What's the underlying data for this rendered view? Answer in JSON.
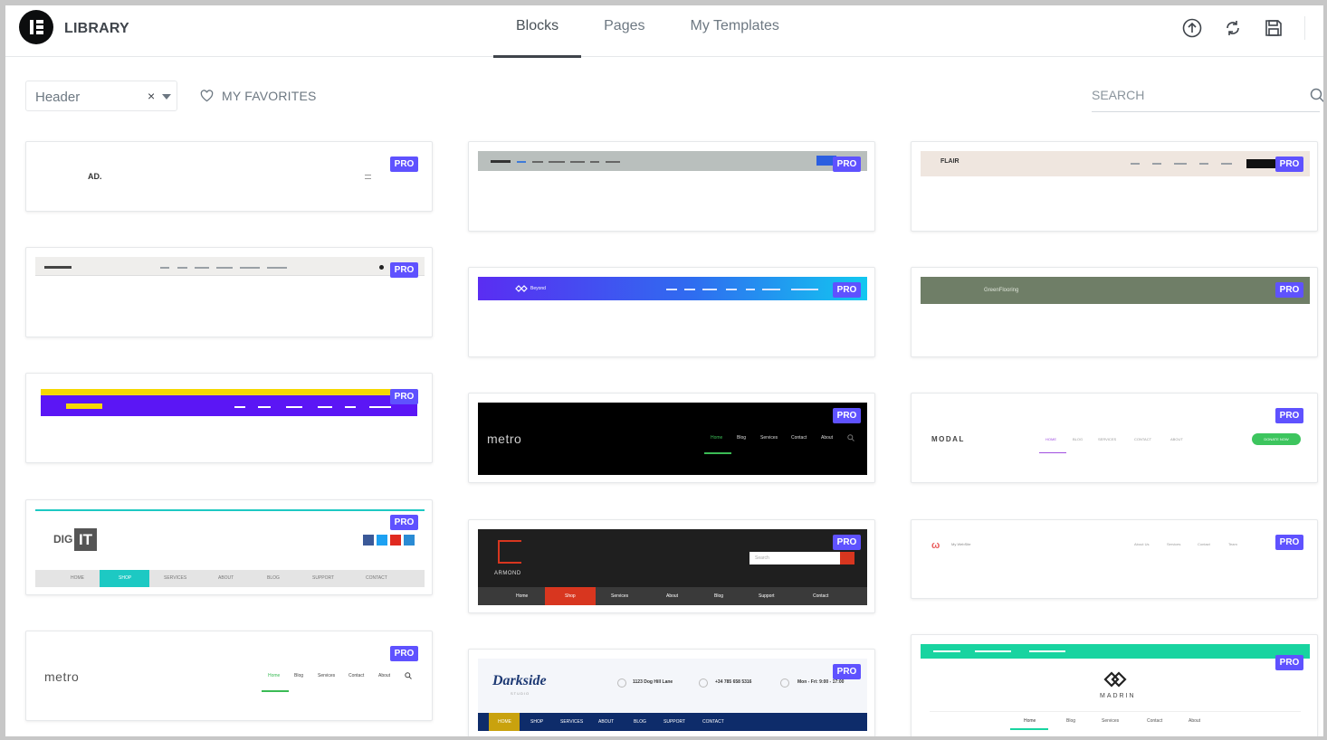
{
  "header": {
    "title": "LIBRARY",
    "tabs": [
      {
        "label": "Blocks",
        "active": true
      },
      {
        "label": "Pages",
        "active": false
      },
      {
        "label": "My Templates",
        "active": false
      }
    ],
    "icons": [
      "upload-icon",
      "sync-icon",
      "save-icon"
    ]
  },
  "filter": {
    "category_value": "Header",
    "clear_glyph": "×",
    "favorites_label": "MY FAVORITES",
    "search_placeholder": "SEARCH"
  },
  "badge_label": "PRO",
  "colors": {
    "accent": "#5f52ff",
    "text": "#6d7882",
    "border": "#e6e8ea"
  },
  "cards": [
    {
      "logo": "AD."
    },
    {
      "logo": "metro",
      "nav": [
        "Home",
        "Blog",
        "Services",
        "Contact",
        "About"
      ]
    },
    {
      "logo": "DIG",
      "logo_box": "IT",
      "nav": [
        "HOME",
        "SHOP",
        "SERVICES",
        "ABOUT",
        "BLOG",
        "SUPPORT",
        "CONTACT"
      ]
    },
    {
      "logo": "Beyond"
    },
    {
      "logo": "metro",
      "nav": [
        "Home",
        "Blog",
        "Services",
        "Contact",
        "About"
      ]
    },
    {
      "logo": "ARMOND",
      "search": "Search",
      "nav": [
        "Home",
        "Shop",
        "Services",
        "About",
        "Blog",
        "Support",
        "Contact"
      ]
    },
    {
      "logo": "Darkside",
      "tagline": "STUDIO",
      "info": [
        "1123 Dog Hill Lane",
        "+34 785 658 5316",
        "Mon - Fri: 9:00 - 17:00"
      ],
      "nav": [
        "HOME",
        "SHOP",
        "SERVICES",
        "ABOUT",
        "BLOG",
        "SUPPORT",
        "CONTACT"
      ]
    },
    {
      "logo": "FLAIR"
    },
    {
      "logo": "GreenFlooring"
    },
    {
      "logo": "MODAL",
      "nav": [
        "HOME",
        "BLOG",
        "SERVICES",
        "CONTACT",
        "ABOUT"
      ],
      "cta": "DONATE NOW"
    },
    {
      "logo": "My WebSite",
      "nav": [
        "About Us",
        "Services",
        "Contact",
        "Team"
      ]
    },
    {
      "logo": "MADRIN",
      "nav": [
        "Home",
        "Blog",
        "Services",
        "Contact",
        "About"
      ]
    }
  ]
}
